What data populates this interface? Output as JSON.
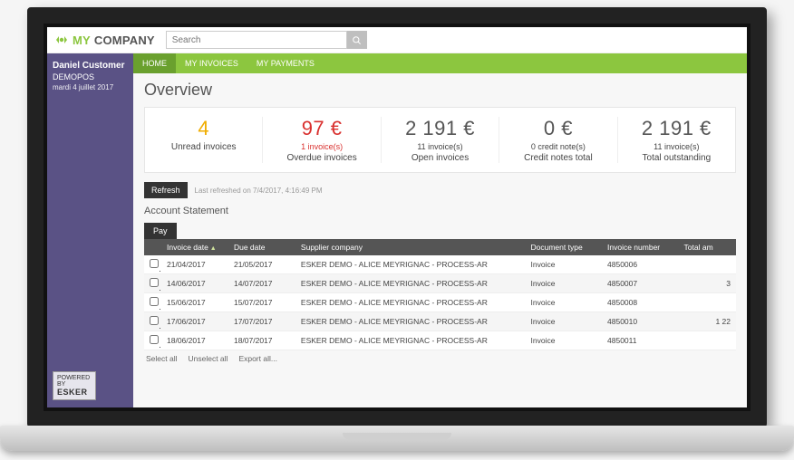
{
  "logo": {
    "my": "MY",
    "company": "COMPANY"
  },
  "search": {
    "placeholder": "Search"
  },
  "user": {
    "name": "Daniel Customer",
    "org": "DEMOPOS",
    "date": "mardi 4 juillet 2017"
  },
  "powered": {
    "line1": "POWERED BY",
    "line2": "ESKER"
  },
  "nav": {
    "home": "HOME",
    "invoices": "MY INVOICES",
    "payments": "MY PAYMENTS"
  },
  "page": {
    "title": "Overview"
  },
  "kpis": [
    {
      "value": "4",
      "sub": "",
      "label": "Unread invoices",
      "cls": "warn"
    },
    {
      "value": "97 €",
      "sub": "1 invoice(s)",
      "label": "Overdue invoices",
      "cls": "alert"
    },
    {
      "value": "2 191 €",
      "sub": "11 invoice(s)",
      "label": "Open invoices",
      "cls": ""
    },
    {
      "value": "0 €",
      "sub": "0 credit note(s)",
      "label": "Credit notes total",
      "cls": ""
    },
    {
      "value": "2 191 €",
      "sub": "11 invoice(s)",
      "label": "Total outstanding",
      "cls": ""
    }
  ],
  "refresh": {
    "button": "Refresh",
    "text": "Last refreshed on 7/4/2017, 4:16:49 PM"
  },
  "statement": {
    "title": "Account Statement",
    "pay": "Pay",
    "headers": {
      "invoice_date": "Invoice date",
      "due_date": "Due date",
      "supplier": "Supplier company",
      "doc_type": "Document type",
      "inv_no": "Invoice number",
      "total": "Total am"
    },
    "rows": [
      {
        "inv": "21/04/2017",
        "due": "21/05/2017",
        "sup": "ESKER DEMO - ALICE MEYRIGNAC - PROCESS-AR",
        "type": "Invoice",
        "num": "4850006",
        "amt": ""
      },
      {
        "inv": "14/06/2017",
        "due": "14/07/2017",
        "sup": "ESKER DEMO - ALICE MEYRIGNAC - PROCESS-AR",
        "type": "Invoice",
        "num": "4850007",
        "amt": "3"
      },
      {
        "inv": "15/06/2017",
        "due": "15/07/2017",
        "sup": "ESKER DEMO - ALICE MEYRIGNAC - PROCESS-AR",
        "type": "Invoice",
        "num": "4850008",
        "amt": ""
      },
      {
        "inv": "17/06/2017",
        "due": "17/07/2017",
        "sup": "ESKER DEMO - ALICE MEYRIGNAC - PROCESS-AR",
        "type": "Invoice",
        "num": "4850010",
        "amt": "1 22"
      },
      {
        "inv": "18/06/2017",
        "due": "18/07/2017",
        "sup": "ESKER DEMO - ALICE MEYRIGNAC - PROCESS-AR",
        "type": "Invoice",
        "num": "4850011",
        "amt": ""
      }
    ],
    "actions": {
      "select_all": "Select all",
      "unselect_all": "Unselect all",
      "export": "Export all..."
    }
  }
}
